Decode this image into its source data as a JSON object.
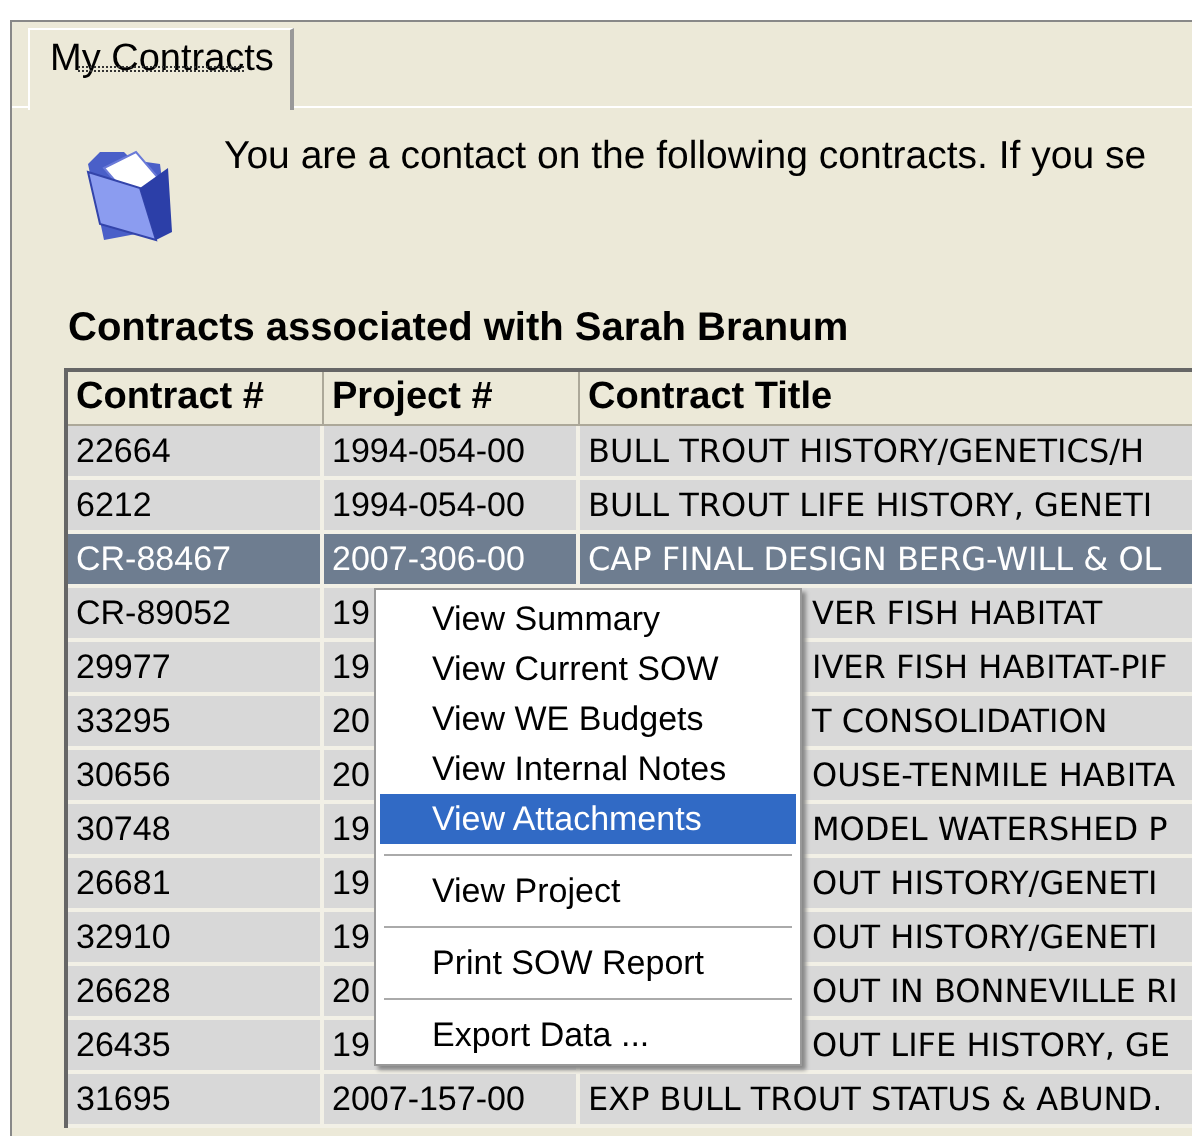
{
  "tabs": [
    {
      "label": "My Contracts",
      "selected": true
    }
  ],
  "intro": "You are a contact on the following contracts. If you se",
  "table_title": "Contracts associated with Sarah Branum",
  "table": {
    "columns": [
      "Contract #",
      "Project #",
      "Contract Title"
    ],
    "rows": [
      {
        "cells": [
          "22664",
          "1994-054-00",
          "BULL TROUT HISTORY/GENETICS/H"
        ],
        "selected": false,
        "covered": false
      },
      {
        "cells": [
          "6212",
          "1994-054-00",
          "BULL TROUT LIFE HISTORY, GENETI"
        ],
        "selected": false,
        "covered": false
      },
      {
        "cells": [
          "CR-88467",
          "2007-306-00",
          "CAP FINAL DESIGN BERG-WILL & OL"
        ],
        "selected": true,
        "covered": false
      },
      {
        "cells": [
          "CR-89052",
          "19",
          "VER FISH HABITAT"
        ],
        "selected": false,
        "covered": true
      },
      {
        "cells": [
          "29977",
          "19",
          "IVER FISH HABITAT-PIF"
        ],
        "selected": false,
        "covered": true
      },
      {
        "cells": [
          "33295",
          "20",
          "T CONSOLIDATION"
        ],
        "selected": false,
        "covered": true
      },
      {
        "cells": [
          "30656",
          "20",
          "OUSE-TENMILE HABITA"
        ],
        "selected": false,
        "covered": true
      },
      {
        "cells": [
          "30748",
          "19",
          "MODEL WATERSHED P"
        ],
        "selected": false,
        "covered": true
      },
      {
        "cells": [
          "26681",
          "19",
          "OUT HISTORY/GENETI"
        ],
        "selected": false,
        "covered": true
      },
      {
        "cells": [
          "32910",
          "19",
          "OUT HISTORY/GENETI"
        ],
        "selected": false,
        "covered": true
      },
      {
        "cells": [
          "26628",
          "20",
          "OUT IN BONNEVILLE RI"
        ],
        "selected": false,
        "covered": true
      },
      {
        "cells": [
          "26435",
          "19",
          "OUT LIFE HISTORY, GE"
        ],
        "selected": false,
        "covered": true
      },
      {
        "cells": [
          "31695",
          "2007-157-00",
          "EXP BULL TROUT STATUS & ABUND."
        ],
        "selected": false,
        "covered": false
      }
    ]
  },
  "context_menu": {
    "items": [
      {
        "kind": "item",
        "label": "View Summary",
        "selected": false
      },
      {
        "kind": "item",
        "label": "View Current SOW",
        "selected": false
      },
      {
        "kind": "item",
        "label": "View WE Budgets",
        "selected": false
      },
      {
        "kind": "item",
        "label": "View Internal Notes",
        "selected": false
      },
      {
        "kind": "item",
        "label": "View Attachments",
        "selected": true
      },
      {
        "kind": "separator"
      },
      {
        "kind": "item",
        "label": "View Project",
        "selected": false
      },
      {
        "kind": "separator"
      },
      {
        "kind": "item",
        "label": "Print SOW Report",
        "selected": false
      },
      {
        "kind": "separator"
      },
      {
        "kind": "item",
        "label": "Export Data ...",
        "selected": false
      }
    ]
  }
}
